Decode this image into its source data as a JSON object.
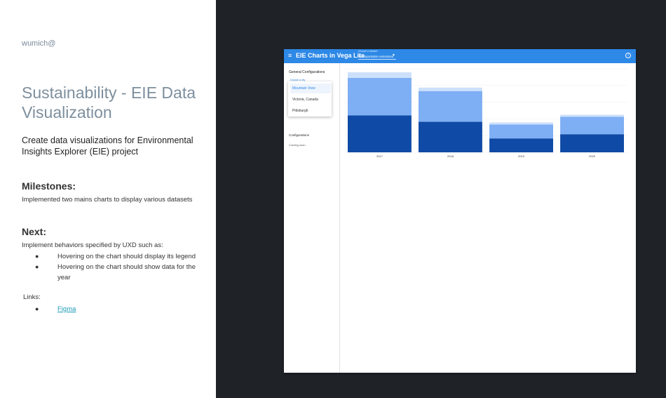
{
  "slide": {
    "author": "wumich@",
    "title": "Sustainability - EIE Data Visualization",
    "description": "Create data visualizations for Environmental Insights Explorer (EIE) project",
    "milestones_heading": "Milestones:",
    "milestones_text": "Implemented two mains charts to display various datasets",
    "next_heading": "Next:",
    "next_intro": "Implement behaviors specified by UXD such as:",
    "next_items": [
      "Hovering on the chart  should display its legend",
      "Hovering on the chart should show data for the year"
    ],
    "links_label": "Links:",
    "links": [
      "Figma"
    ],
    "link_color": "#1a9bb8"
  },
  "app": {
    "title": "EIE Charts in Vega Lite",
    "dataset_label": "Choose a dataset",
    "dataset_value": "Transportation emissions",
    "appbar_color": "#2d88e6",
    "sidebar": {
      "general_configurations": "General Configurations",
      "city_label": "Choose a city",
      "city_options": [
        "Mountain View",
        "Victoria, Canada",
        "Pittsburgh"
      ],
      "selected_city": "Mountain View",
      "configurations": "Configurations",
      "coming_soon": "Coming soon"
    }
  },
  "chart_data": {
    "type": "bar",
    "stacked": true,
    "categories": [
      "2017",
      "2018",
      "2019",
      "2020"
    ],
    "series": [
      {
        "values": [
          53,
          44,
          20,
          26
        ],
        "color": "#0f4aa6"
      },
      {
        "values": [
          54,
          44,
          20,
          25
        ],
        "color": "#7eaef4"
      },
      {
        "values": [
          8,
          5,
          3,
          3
        ],
        "color": "#cde0fb"
      }
    ],
    "ylim": [
      0,
      120
    ],
    "grid": true
  }
}
